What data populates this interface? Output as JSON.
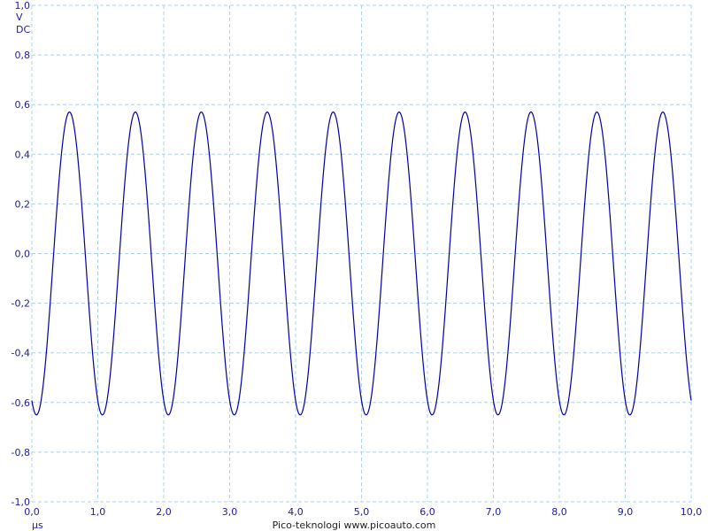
{
  "chart_data": {
    "type": "line",
    "title": "",
    "xlabel": "µs",
    "ylabel": "V DC",
    "y_unit_lines": [
      "V",
      "DC"
    ],
    "x_unit": "µs",
    "xlim": [
      0.0,
      10.0
    ],
    "ylim": [
      -1.0,
      1.0
    ],
    "x_ticks": [
      "0,0",
      "1,0",
      "2,0",
      "3,0",
      "4,0",
      "5,0",
      "6,0",
      "7,0",
      "8,0",
      "9,0",
      "10,0"
    ],
    "y_ticks": [
      "1,0",
      "0,8",
      "0,6",
      "0,4",
      "0,2",
      "0,0",
      "-0,2",
      "-0,4",
      "-0,6",
      "-0,8",
      "-1,0"
    ],
    "grid": true,
    "series": [
      {
        "color": "#0000a0",
        "waveform": "sine",
        "frequency_mhz": 1.0,
        "period_us": 1.0,
        "max_v": 0.57,
        "min_v": -0.65,
        "first_peak_us": 0.57,
        "x": [
          0.0,
          0.1,
          0.2,
          0.3,
          0.4,
          0.5,
          0.57,
          0.7,
          0.8,
          0.9,
          1.0,
          1.07,
          1.2,
          1.3,
          1.4,
          1.5,
          1.57,
          1.7,
          1.8,
          1.9,
          2.0,
          2.07,
          2.2,
          2.3,
          2.4,
          2.5,
          2.57,
          2.7,
          2.8,
          2.9,
          3.0,
          3.07,
          3.2,
          3.3,
          3.4,
          3.5,
          3.57,
          3.7,
          3.8,
          3.9,
          4.0,
          4.07,
          4.2,
          4.3,
          4.4,
          4.5,
          4.57,
          4.7,
          4.8,
          4.9,
          5.0,
          5.07,
          5.2,
          5.3,
          5.4,
          5.5,
          5.57,
          5.7,
          5.8,
          5.9,
          6.0,
          6.07,
          6.2,
          6.3,
          6.4,
          6.5,
          6.57,
          6.7,
          6.8,
          6.9,
          7.0,
          7.07,
          7.2,
          7.3,
          7.4,
          7.5,
          7.57,
          7.7,
          7.8,
          7.9,
          8.0,
          8.07,
          8.2,
          8.3,
          8.4,
          8.5,
          8.57,
          8.7,
          8.8,
          8.9,
          9.0,
          9.07,
          9.2,
          9.3,
          9.4,
          9.5,
          9.57,
          9.7,
          9.8,
          9.9,
          10.0
        ],
        "y": [
          -0.62,
          -0.48,
          -0.18,
          0.18,
          0.45,
          0.56,
          0.57,
          0.44,
          0.15,
          -0.22,
          -0.53,
          -0.65,
          -0.48,
          -0.18,
          0.18,
          0.45,
          0.57,
          0.44,
          0.15,
          -0.22,
          -0.53,
          -0.65,
          -0.48,
          -0.18,
          0.18,
          0.45,
          0.57,
          0.44,
          0.15,
          -0.22,
          -0.53,
          -0.65,
          -0.48,
          -0.18,
          0.18,
          0.45,
          0.57,
          0.44,
          0.15,
          -0.22,
          -0.53,
          -0.65,
          -0.48,
          -0.18,
          0.18,
          0.45,
          0.57,
          0.44,
          0.15,
          -0.22,
          -0.53,
          -0.65,
          -0.48,
          -0.18,
          0.18,
          0.45,
          0.57,
          0.44,
          0.15,
          -0.22,
          -0.53,
          -0.65,
          -0.48,
          -0.18,
          0.18,
          0.45,
          0.57,
          0.44,
          0.15,
          -0.22,
          -0.53,
          -0.65,
          -0.48,
          -0.18,
          0.18,
          0.45,
          0.57,
          0.44,
          0.15,
          -0.22,
          -0.53,
          -0.65,
          -0.48,
          -0.18,
          0.18,
          0.45,
          0.57,
          0.44,
          0.15,
          -0.22,
          -0.53,
          -0.65,
          -0.48,
          -0.18,
          0.18,
          0.45,
          0.57,
          0.44,
          0.15,
          -0.22,
          -0.53
        ]
      }
    ]
  },
  "footer": {
    "branding": "Pico-teknologi  www.picoauto.com"
  },
  "colors": {
    "grid": "#a9d4e6",
    "trace": "#0000a0",
    "labels": "#1a1aa0",
    "background": "#ffffff"
  }
}
